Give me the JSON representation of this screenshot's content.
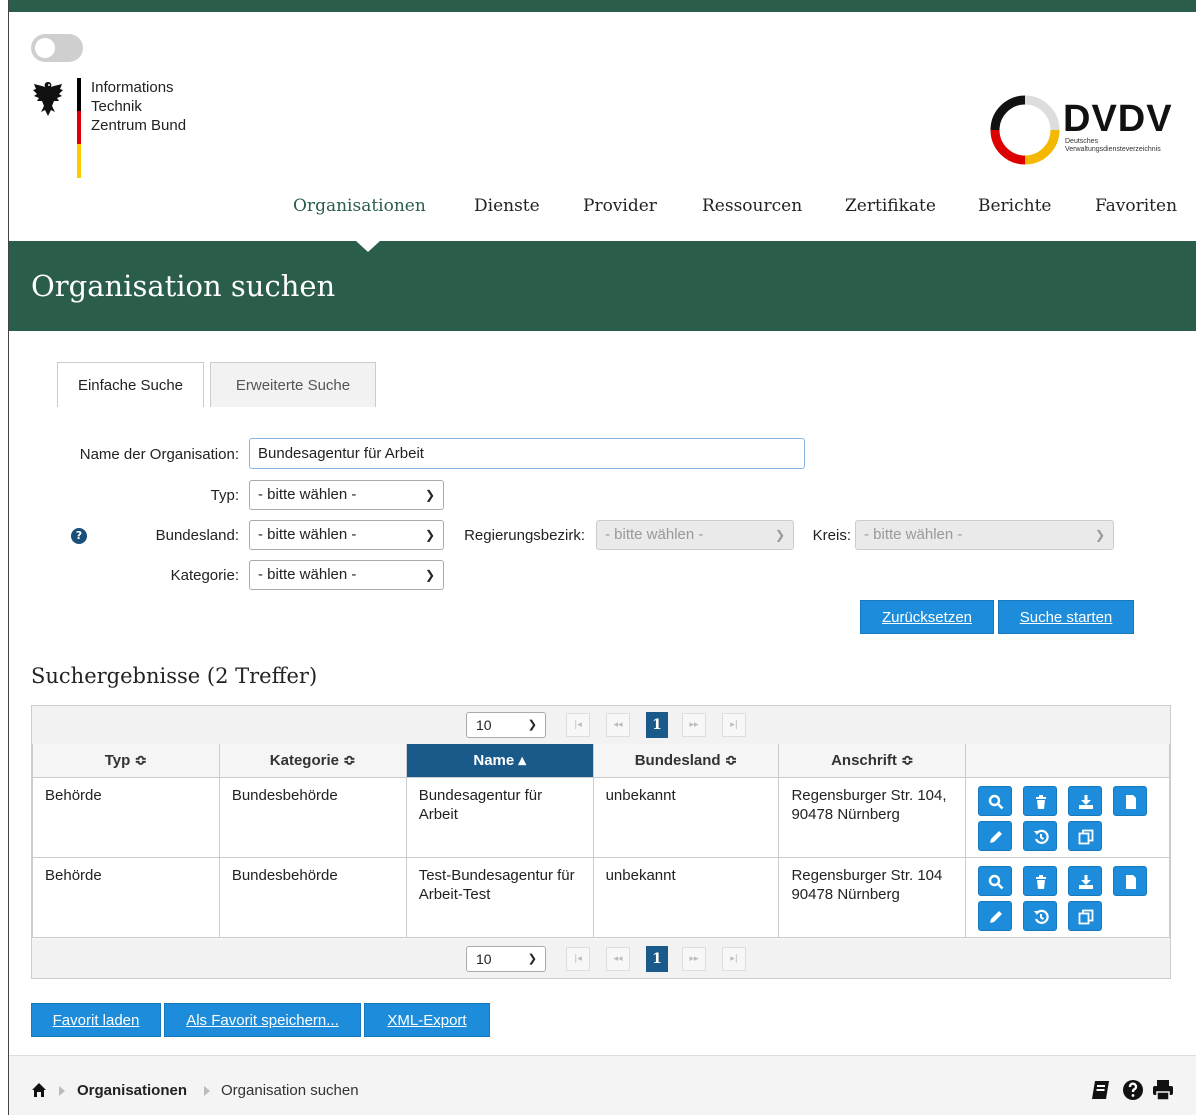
{
  "header": {
    "itz_logo_lines": [
      "Informations",
      "Technik",
      "Zentrum Bund"
    ],
    "dvdv_logo_title": "DVDV",
    "dvdv_logo_sub_1": "Deutsches",
    "dvdv_logo_sub_2": "Verwaltungsdiensteverzeichnis"
  },
  "nav": {
    "items": [
      "Organisationen",
      "Dienste",
      "Provider",
      "Ressourcen",
      "Zertifikate",
      "Berichte",
      "Favoriten"
    ],
    "active_index": 0
  },
  "page": {
    "title": "Organisation suchen"
  },
  "tabs": [
    "Einfache Suche",
    "Erweiterte Suche"
  ],
  "form": {
    "name_label": "Name der Organisation:",
    "name_value": "Bundesagentur für Arbeit",
    "typ_label": "Typ:",
    "typ_value": "- bitte wählen -",
    "bundesland_label": "Bundesland:",
    "bundesland_value": "- bitte wählen -",
    "regbez_label": "Regierungsbezirk:",
    "regbez_value": "- bitte wählen -",
    "kreis_label": "Kreis:",
    "kreis_value": "- bitte wählen -",
    "kategorie_label": "Kategorie:",
    "kategorie_value": "- bitte wählen -",
    "reset_label": "Zurücksetzen",
    "search_label": "Suche starten"
  },
  "results": {
    "title": "Suchergebnisse (2 Treffer)",
    "page_size": "10",
    "current_page": "1",
    "columns": [
      "Typ ≎",
      "Kategorie ≎",
      "Name ▴",
      "Bundesland ≎",
      "Anschrift ≎"
    ],
    "rows": [
      {
        "typ": "Behörde",
        "kategorie": "Bundesbehörde",
        "name": "Bundesagentur für Arbeit",
        "bundesland": "unbekannt",
        "anschrift": "Regensburger Str. 104, 90478 Nürnberg"
      },
      {
        "typ": "Behörde",
        "kategorie": "Bundesbehörde",
        "name": "Test-Bundesagentur für Arbeit-Test",
        "bundesland": "unbekannt",
        "anschrift": "Regensburger Str. 104 90478 Nürnberg"
      }
    ]
  },
  "bottom_buttons": [
    "Favorit laden",
    "Als Favorit speichern...",
    "XML-Export"
  ],
  "breadcrumb": {
    "level1": "Organisationen",
    "level2": "Organisation suchen"
  },
  "colors": {
    "brand_green": "#2a5d4a",
    "button_blue": "#1d8ddb",
    "sorted_header": "#1a5a8a"
  }
}
